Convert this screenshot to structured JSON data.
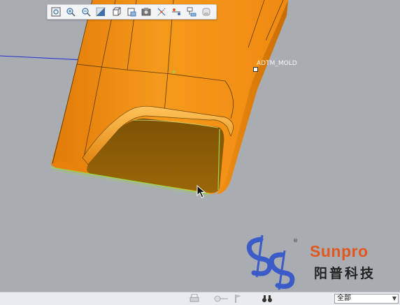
{
  "toolbar": {
    "buttons": [
      {
        "icon": "refit-icon"
      },
      {
        "icon": "zoom-in-icon"
      },
      {
        "icon": "zoom-out-icon"
      },
      {
        "icon": "repaint-icon"
      },
      {
        "icon": "saved-orientations-icon"
      },
      {
        "icon": "view-manager-icon"
      },
      {
        "icon": "display-style-icon"
      },
      {
        "icon": "datum-display-icon"
      },
      {
        "icon": "spin-center-icon"
      },
      {
        "icon": "annotation-display-icon"
      },
      {
        "icon": "appearance-icon"
      }
    ]
  },
  "viewport": {
    "plane_label": "ADTM_MOLD"
  },
  "logo": {
    "english": "Sunpro",
    "chinese": "阳普科技"
  },
  "statusbar": {
    "filter_value": "全部"
  },
  "colors": {
    "background": "#a9adb1",
    "part_orange": "#f0890f",
    "part_dark": "#8a5a06",
    "edge_green": "#9bd34a",
    "plane_blue": "#2b2fd0",
    "logo_blue": "#3b5bc8",
    "logo_orange": "#e2571f"
  }
}
